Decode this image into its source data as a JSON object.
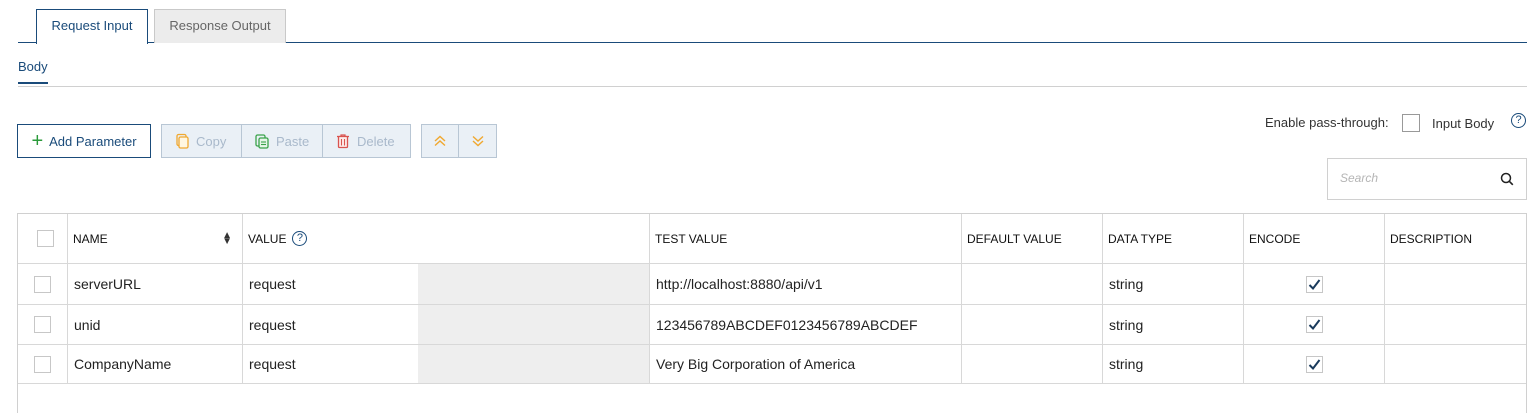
{
  "tabs": [
    {
      "label": "Request Input",
      "active": true
    },
    {
      "label": "Response Output",
      "active": false
    }
  ],
  "subtab": {
    "label": "Body"
  },
  "toolbar": {
    "add_label": "Add Parameter",
    "copy_label": "Copy",
    "paste_label": "Paste",
    "delete_label": "Delete"
  },
  "pass_through": {
    "label": "Enable pass-through:",
    "option_label": "Input Body",
    "checked": false,
    "help": "?"
  },
  "search": {
    "placeholder": "Search",
    "value": ""
  },
  "table": {
    "headers": {
      "name": "NAME",
      "value": "VALUE",
      "value_help": "?",
      "test_value": "TEST VALUE",
      "default_value": "DEFAULT VALUE",
      "data_type": "DATA TYPE",
      "encode": "ENCODE",
      "description": "DESCRIPTION"
    },
    "rows": [
      {
        "name": "serverURL",
        "value": "request",
        "test_value": "http://localhost:8880/api/v1",
        "default_value": "",
        "data_type": "string",
        "encode": true,
        "description": ""
      },
      {
        "name": "unid",
        "value": "request",
        "test_value": "123456789ABCDEF0123456789ABCDEF",
        "default_value": "",
        "data_type": "string",
        "encode": true,
        "description": ""
      },
      {
        "name": "CompanyName",
        "value": "request",
        "test_value": "Very Big Corporation of America",
        "default_value": "",
        "data_type": "string",
        "encode": true,
        "description": ""
      }
    ]
  },
  "colors": {
    "accent": "#1a4b7a",
    "add_plus": "#2a9a3a",
    "copy_icon": "#f0a830",
    "paste_icon": "#3aa34a",
    "delete_icon": "#d9534f",
    "move_icon": "#f0a830",
    "disabled_text": "#a9b9cb"
  },
  "icons": [
    "plus-icon",
    "copy-icon",
    "paste-icon",
    "trash-icon",
    "chevrons-up-icon",
    "chevrons-down-icon",
    "search-icon",
    "help-icon",
    "sort-icon",
    "checkmark-icon"
  ]
}
